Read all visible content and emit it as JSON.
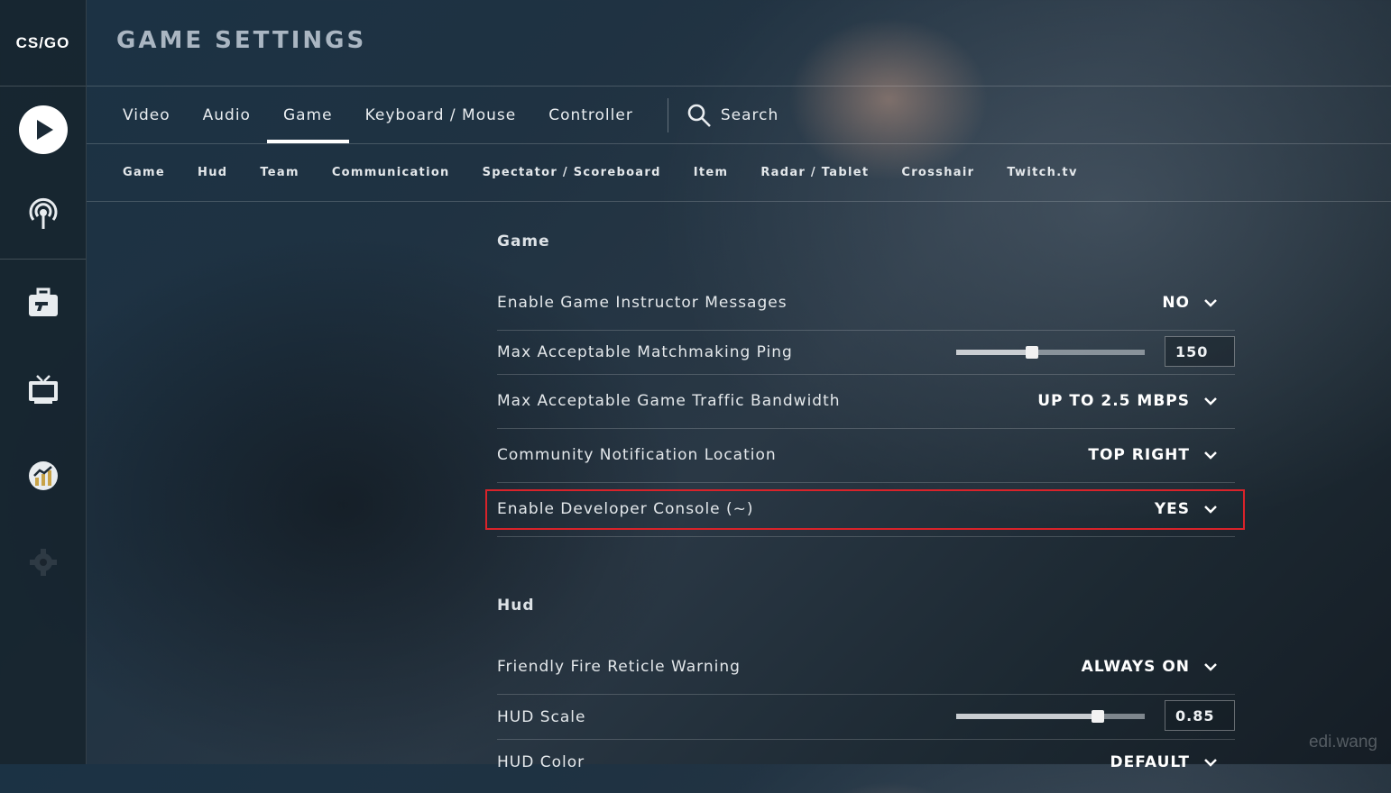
{
  "logo": {
    "text": "CS/GO"
  },
  "sidebar": {
    "items": [
      {
        "name": "play-icon"
      },
      {
        "name": "broadcast-icon"
      },
      {
        "name": "inventory-icon"
      },
      {
        "name": "watch-icon"
      },
      {
        "name": "stats-icon"
      },
      {
        "name": "settings-icon"
      }
    ]
  },
  "header": {
    "title": "GAME SETTINGS"
  },
  "tabs": [
    {
      "label": "Video"
    },
    {
      "label": "Audio"
    },
    {
      "label": "Game",
      "active": true
    },
    {
      "label": "Keyboard / Mouse"
    },
    {
      "label": "Controller"
    }
  ],
  "search": {
    "label": "Search"
  },
  "subtabs": [
    "Game",
    "Hud",
    "Team",
    "Communication",
    "Spectator / Scoreboard",
    "Item",
    "Radar / Tablet",
    "Crosshair",
    "Twitch.tv"
  ],
  "sections": {
    "game": {
      "title": "Game",
      "rows": [
        {
          "label": "Enable Game Instructor Messages",
          "value": "NO"
        },
        {
          "label": "Max Acceptable Matchmaking Ping",
          "value": "150",
          "slider_fraction": 0.4
        },
        {
          "label": "Max Acceptable Game Traffic Bandwidth",
          "value": "UP TO 2.5 MBPS"
        },
        {
          "label": "Community Notification Location",
          "value": "TOP RIGHT"
        },
        {
          "label": "Enable Developer Console (~)",
          "value": "YES",
          "highlighted": true
        }
      ]
    },
    "hud": {
      "title": "Hud",
      "rows": [
        {
          "label": "Friendly Fire Reticle Warning",
          "value": "ALWAYS ON"
        },
        {
          "label": "HUD Scale",
          "value": "0.85",
          "slider_fraction": 0.75
        },
        {
          "label": "HUD Color",
          "value": "DEFAULT"
        }
      ]
    }
  },
  "watermark": "edi.wang",
  "colors": {
    "highlight": "#d9232a",
    "accent": "#ffffff"
  }
}
